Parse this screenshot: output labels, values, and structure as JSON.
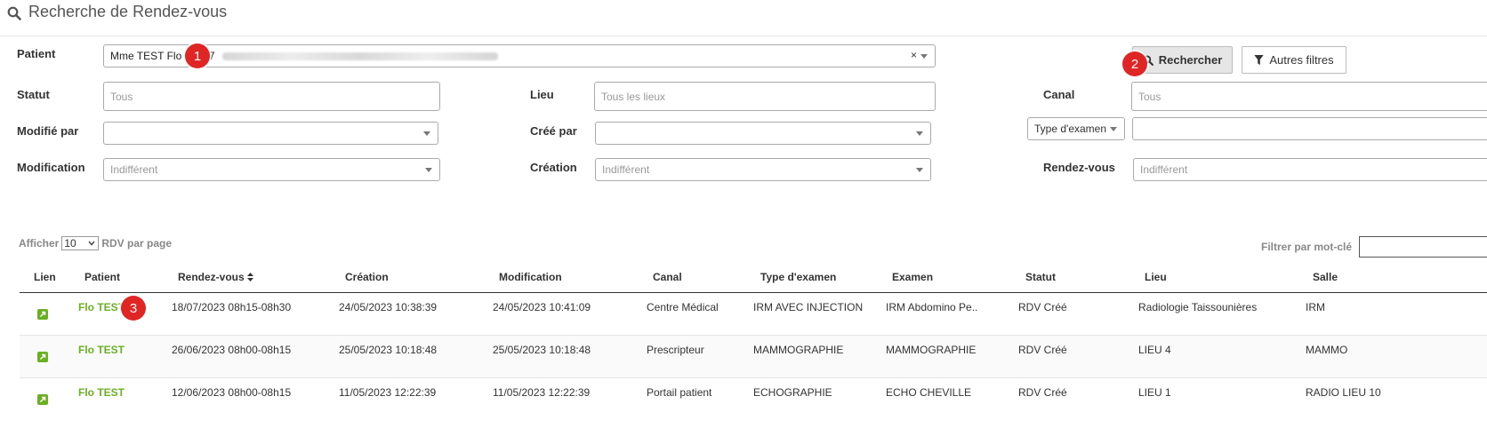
{
  "header": {
    "title": "Recherche de Rendez-vous"
  },
  "filters": {
    "patient_label": "Patient",
    "patient_value": "Mme TEST Flo - 1337",
    "statut_label": "Statut",
    "statut_placeholder": "Tous",
    "lieu_label": "Lieu",
    "lieu_placeholder": "Tous les lieux",
    "canal_label": "Canal",
    "canal_placeholder": "Tous",
    "modifie_label": "Modifié par",
    "cree_label": "Créé par",
    "type_examen_select": "Type d'examen",
    "modification_label": "Modification",
    "modification_value": "Indifférent",
    "creation_label": "Création",
    "creation_value": "Indifférent",
    "rdv_label": "Rendez-vous",
    "rdv_value": "Indifférent"
  },
  "buttons": {
    "search": "Rechercher",
    "more_filters": "Autres filtres"
  },
  "badges": {
    "b1": "1",
    "b2": "2",
    "b3": "3"
  },
  "list": {
    "show_label": "Afficher",
    "per_page": "10",
    "per_page_suffix": "RDV par page",
    "filter_label": "Filtrer par mot-clé"
  },
  "table": {
    "headers": [
      "Lien",
      "Patient",
      "Rendez-vous",
      "Création",
      "Modification",
      "Canal",
      "Type d'examen",
      "Examen",
      "Statut",
      "Lieu",
      "Salle"
    ],
    "rows": [
      [
        "Flo TEST",
        "18/07/2023 08h15-08h30",
        "24/05/2023 10:38:39",
        "24/05/2023 10:41:09",
        "Centre Médical",
        "IRM AVEC INJECTION",
        "IRM Abdomino Pe..",
        "RDV Créé",
        "Radiologie Taissounières",
        "IRM"
      ],
      [
        "Flo TEST",
        "26/06/2023 08h00-08h15",
        "25/05/2023 10:18:48",
        "25/05/2023 10:18:48",
        "Prescripteur",
        "MAMMOGRAPHIE",
        "MAMMOGRAPHIE",
        "RDV Créé",
        "LIEU 4",
        "MAMMO"
      ],
      [
        "Flo TEST",
        "12/06/2023 08h00-08h15",
        "11/05/2023 12:22:39",
        "11/05/2023 12:22:39",
        "Portail patient",
        "ECHOGRAPHIE",
        "ECHO CHEVILLE",
        "RDV Créé",
        "LIEU 1",
        "RADIO LIEU 10"
      ]
    ]
  }
}
